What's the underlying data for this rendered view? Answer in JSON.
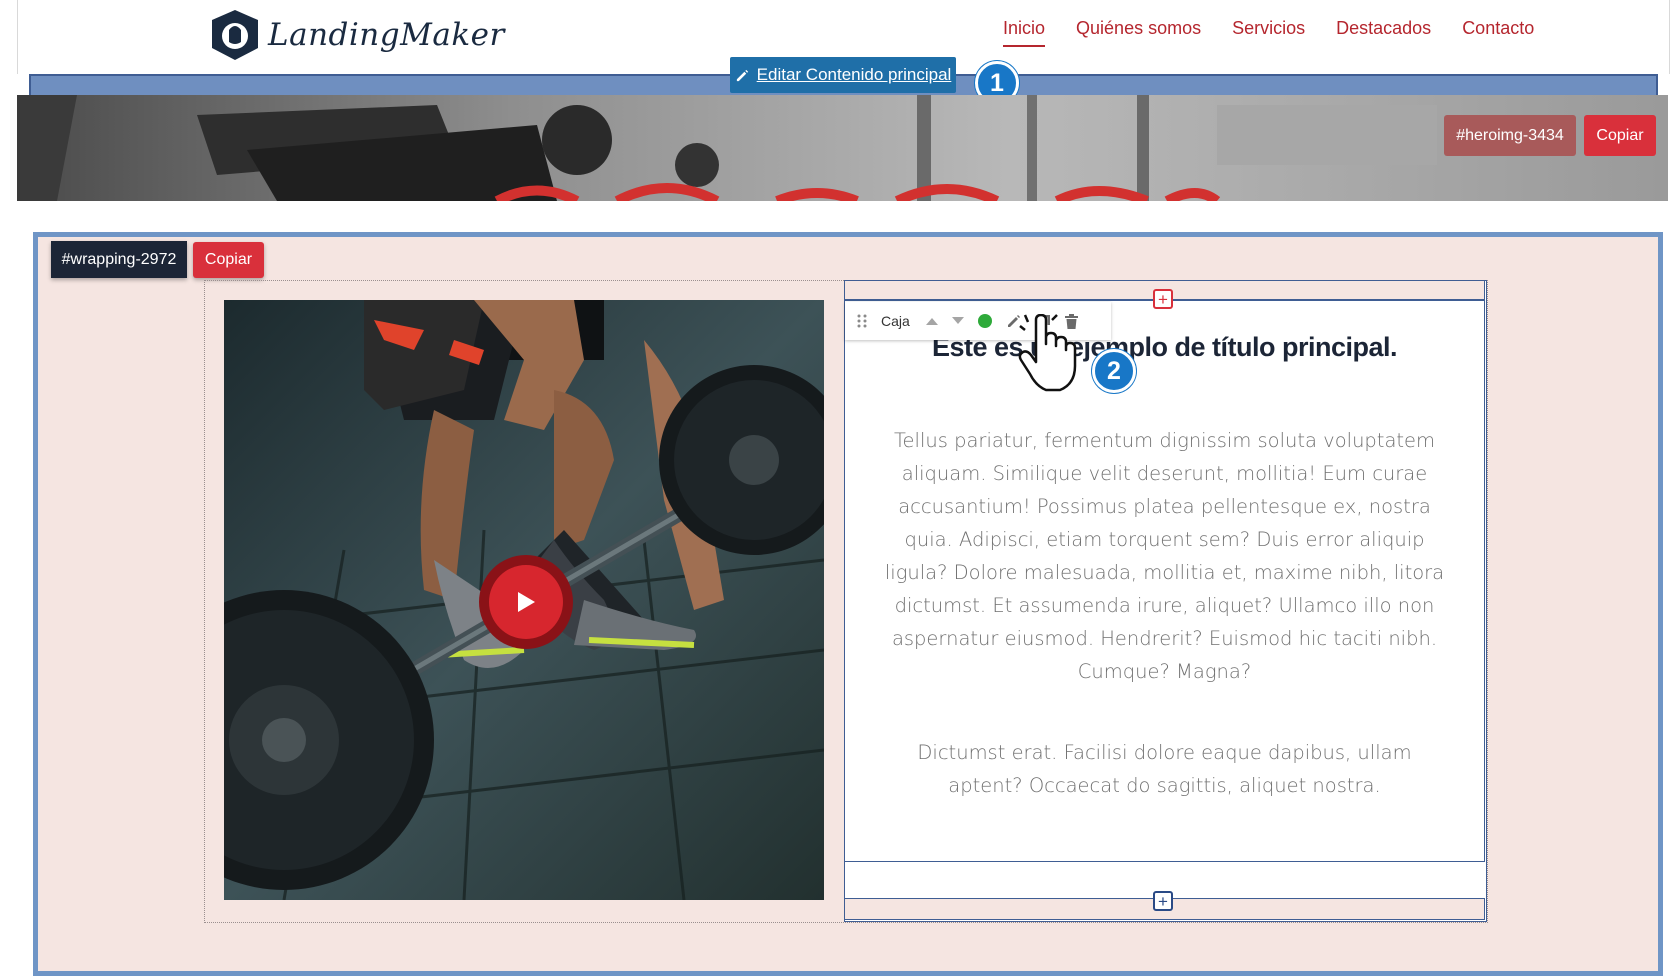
{
  "header": {
    "logo_text": "LandingMaker",
    "nav": [
      {
        "label": "Inicio",
        "active": true
      },
      {
        "label": "Quiénes somos"
      },
      {
        "label": "Servicios"
      },
      {
        "label": "Destacados"
      },
      {
        "label": "Contacto"
      }
    ]
  },
  "editor": {
    "edit_main_label": "Editar Contenido principal",
    "step_1": "1",
    "step_2": "2"
  },
  "hero": {
    "id_tag": "#heroimg-3434",
    "copy_label": "Copiar"
  },
  "wrapping": {
    "id_tag": "#wrapping-2972",
    "copy_label": "Copiar"
  },
  "toolbar": {
    "label": "Caja",
    "icons": [
      "drag-handle-icon",
      "arrow-up-icon",
      "arrow-down-icon",
      "status-dot-icon",
      "pencil-icon",
      "duplicate-icon",
      "trash-icon"
    ]
  },
  "content": {
    "heading": "Este es un ejemplo de título principal.",
    "paragraph_1": "Tellus pariatur, fermentum dignissim soluta voluptatem aliquam. Similique velit deserunt, mollitia! Eum curae accusantium! Possimus platea pellentesque ex, nostra quia. Adipisci, etiam torquent sem? Duis error aliquip ligula? Dolore malesuada, mollitia et, maxime nibh, litora dictumst. Et assumenda irure, aliquet? Ullamco illo non aspernatur eiusmod. Hendrerit? Euismod hic taciti nibh. Cumque? Magna?",
    "paragraph_2": "Dictumst erat. Facilisi dolore eaque dapibus, ullam aptent? Occaecat do sagittis, aliquet nostra.",
    "add_symbol": "+"
  },
  "colors": {
    "accent_red": "#d9303b",
    "nav_red": "#b5262e",
    "editor_blue": "#1f6fa8",
    "section_bg": "#f5e5e1",
    "frame_blue": "#6f95c6"
  }
}
